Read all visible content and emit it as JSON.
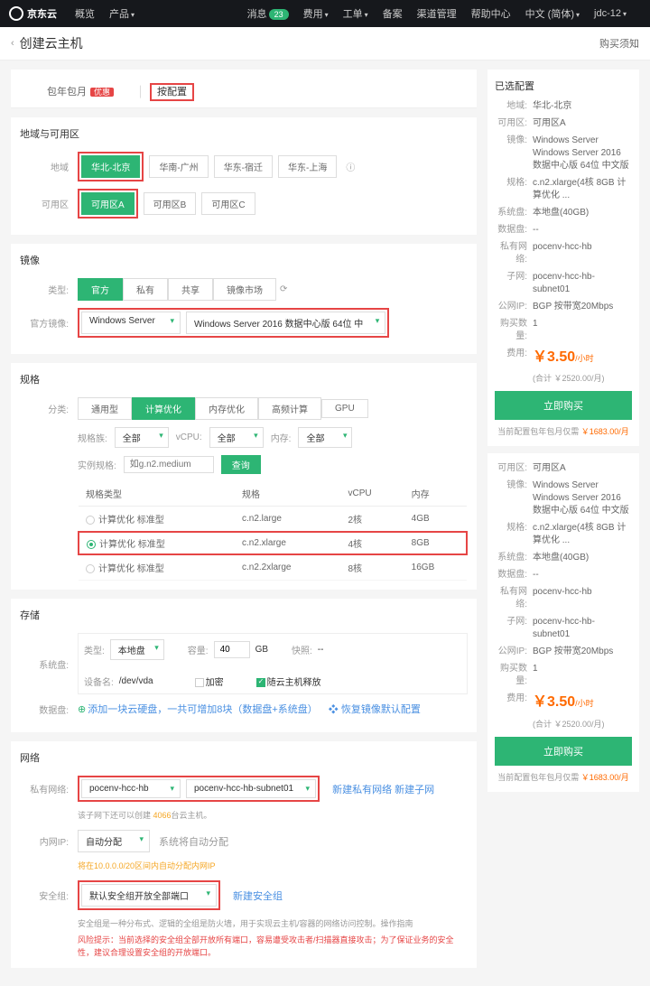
{
  "nav": {
    "brand": "京东云",
    "items": [
      "概览",
      "产品"
    ],
    "right": [
      "消息",
      "费用",
      "工单",
      "备案",
      "渠道管理",
      "帮助中心",
      "中文 (简体)",
      "jdc-12"
    ],
    "msg_count": "23"
  },
  "header": {
    "back": "‹",
    "title": "创建云主机",
    "notice": "购买须知"
  },
  "billing": {
    "tab1": "包年包月",
    "promo": "优惠",
    "tab2": "按配置"
  },
  "region": {
    "title": "地域与可用区",
    "label_region": "地域",
    "regions": [
      "华北-北京",
      "华南-广州",
      "华东-宿迁",
      "华东-上海"
    ],
    "label_az": "可用区",
    "azs": [
      "可用区A",
      "可用区B",
      "可用区C"
    ]
  },
  "image": {
    "title": "镜像",
    "label_type": "类型:",
    "types": [
      "官方",
      "私有",
      "共享",
      "镜像市场"
    ],
    "label_official": "官方镜像:",
    "os_select": "Windows Server",
    "ver_select": "Windows Server 2016 数据中心版 64位 中"
  },
  "spec": {
    "title": "规格",
    "label_cat": "分类:",
    "cats": [
      "通用型",
      "计算优化",
      "内存优化",
      "高频计算",
      "GPU"
    ],
    "family": "规格族:",
    "family_v": "全部",
    "vcpu": "vCPU:",
    "vcpu_v": "全部",
    "mem": "内存:",
    "mem_v": "全部",
    "inst": "实例规格:",
    "inst_ph": "如g.n2.medium",
    "search": "查询",
    "cols": [
      "规格类型",
      "规格",
      "vCPU",
      "内存"
    ],
    "rows": [
      {
        "type": "计算优化 标准型",
        "spec": "c.n2.large",
        "cpu": "2核",
        "mem": "4GB",
        "sel": false
      },
      {
        "type": "计算优化 标准型",
        "spec": "c.n2.xlarge",
        "cpu": "4核",
        "mem": "8GB",
        "sel": true
      },
      {
        "type": "计算优化 标准型",
        "spec": "c.n2.2xlarge",
        "cpu": "8核",
        "mem": "16GB",
        "sel": false
      }
    ]
  },
  "storage": {
    "title": "存储",
    "label_sys": "系统盘:",
    "type": "类型:",
    "type_v": "本地盘",
    "cap": "容量:",
    "cap_v": "40",
    "gb": "GB",
    "snap": "快照:",
    "snap_v": "--",
    "dev": "设备名:",
    "dev_v": "/dev/vda",
    "encrypt": "加密",
    "release": "随云主机释放",
    "label_data": "数据盘:",
    "add": "添加一块云硬盘，一共可增加8块（数据盘+系统盘）",
    "restore": "❖ 恢复镜像默认配置"
  },
  "network": {
    "title": "网络",
    "label_vpc": "私有网络:",
    "vpc": "pocenv-hcc-hb",
    "subnet": "pocenv-hcc-hb-subnet01",
    "create_vpc": "新建私有网络 新建子网",
    "hint_pre": "该子网下还可以创建 ",
    "hint_num": "4066",
    "hint_post": "台云主机。",
    "label_ip": "内网IP:",
    "ip_mode": "自动分配",
    "ip_note": "系统将自动分配",
    "ip_hint": "将在10.0.0.0/20区间内自动分配内网IP",
    "label_sg": "安全组:",
    "sg": "默认安全组开放全部端口",
    "create_sg": "新建安全组",
    "sg_hint": "安全组是一种分布式、逻辑的全组是防火墙，用于实现云主机/容器的网络访问控制。操作指南",
    "sg_warn": "风险提示：当前选择的安全组全部开放所有端口，容易遭受攻击者/扫描器直接攻击；为了保证业务的安全性，建议合理设置安全组的开放端口。"
  },
  "summary": {
    "title": "已选配置",
    "rows": [
      [
        "地域",
        "华北-北京"
      ],
      [
        "可用区",
        "可用区A"
      ],
      [
        "镜像",
        "Windows Server Windows Server 2016 数据中心版 64位 中文版"
      ],
      [
        "规格",
        "c.n2.xlarge(4核 8GB 计算优化 ..."
      ],
      [
        "系统盘",
        "本地盘(40GB)"
      ],
      [
        "数据盘",
        "--"
      ],
      [
        "私有网络",
        "pocenv-hcc-hb"
      ],
      [
        "子网",
        "pocenv-hcc-hb-subnet01"
      ],
      [
        "公网IP",
        "BGP 按带宽20Mbps"
      ],
      [
        "购买数量",
        "1"
      ]
    ],
    "fee_label": "费用:",
    "price": "￥3.50",
    "unit": "/小时",
    "sub": "(合计 ￥2520.00/月)",
    "buy": "立即购买",
    "promo": "当前配置包年包月仅需",
    "promo_amt": "￥1683.00/月"
  },
  "summary2": {
    "rows": [
      [
        "可用区",
        "可用区A"
      ],
      [
        "镜像",
        "Windows Server Windows Server 2016 数据中心版 64位 中文版"
      ],
      [
        "规格",
        "c.n2.xlarge(4核 8GB 计算优化 ..."
      ],
      [
        "系统盘",
        "本地盘(40GB)"
      ],
      [
        "数据盘",
        "--"
      ],
      [
        "私有网络",
        "pocenv-hcc-hb"
      ],
      [
        "子网",
        "pocenv-hcc-hb-subnet01"
      ],
      [
        "公网IP",
        "BGP 按带宽20Mbps"
      ],
      [
        "购买数量",
        "1"
      ]
    ]
  }
}
